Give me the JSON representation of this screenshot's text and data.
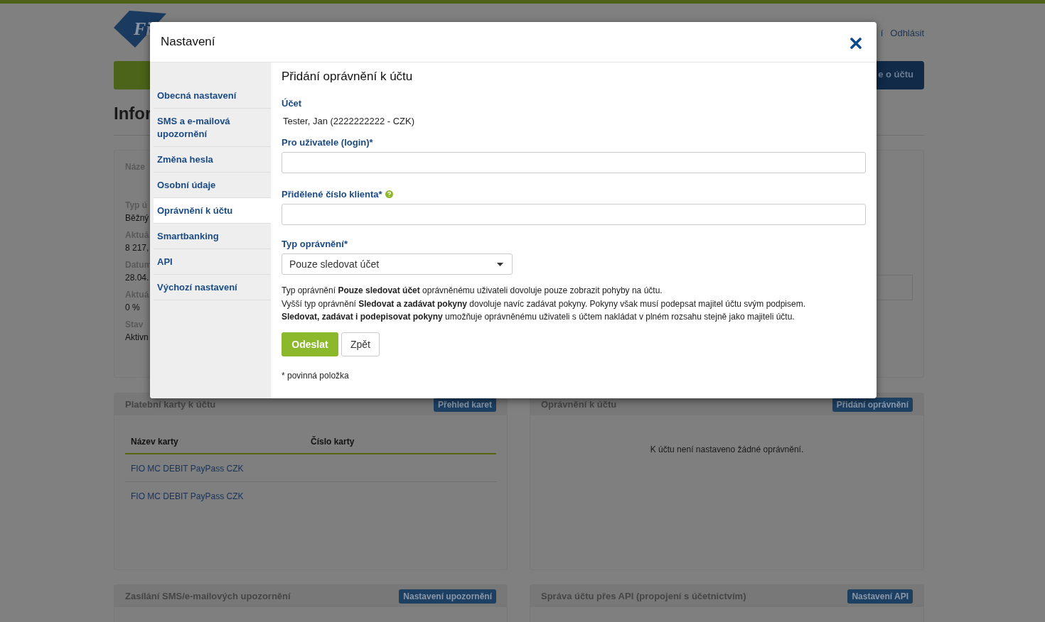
{
  "header": {
    "logo_text": "Fi",
    "links": [
      "í",
      "Odhlásit"
    ]
  },
  "nav": {
    "account_button": "e o účtu"
  },
  "page_heading": "Infor",
  "account_card": {
    "fields": [
      {
        "label": "Náze"
      },
      {
        "label": "Typ ú",
        "value": "Běžný"
      },
      {
        "label": "Aktuá",
        "value": "8 217,"
      },
      {
        "label": "Datum",
        "value": "28.04."
      },
      {
        "label": "Aktuá",
        "value": "0 %"
      },
      {
        "label": "Stav",
        "value": "Aktivn"
      }
    ]
  },
  "panels": [
    {
      "kind": "table",
      "title": "Platební karty k účtu",
      "button": "Přehled karet",
      "columns": [
        "Název karty",
        "Číslo karty"
      ],
      "rows": [
        "FIO MC DEBIT PayPass CZK",
        "FIO MC DEBIT PayPass CZK"
      ]
    },
    {
      "kind": "message",
      "title": "Oprávnění k účtu",
      "button": "Přidání oprávnění",
      "message": "K účtu není nastaveno žádné oprávnění."
    },
    {
      "kind": "collapsed",
      "title": "Zasílání SMS/e-mailových upozornění",
      "button": "Nastavení upozornění"
    },
    {
      "kind": "collapsed",
      "title": "Správa účtu přes API (propojení s účetnictvím)",
      "button": "Nastavení API"
    }
  ],
  "modal": {
    "title": "Nastavení",
    "sidebar": [
      {
        "label": "Obecná nastavení",
        "selected": false
      },
      {
        "label": "SMS a e-mailová upozornění",
        "selected": false
      },
      {
        "label": "Změna hesla",
        "selected": false
      },
      {
        "label": "Osobní údaje",
        "selected": false
      },
      {
        "label": "Oprávnění k účtu",
        "selected": true
      },
      {
        "label": "Smartbanking",
        "selected": false
      },
      {
        "label": "API",
        "selected": false
      },
      {
        "label": "Výchozí nastavení",
        "selected": false
      }
    ],
    "form": {
      "heading": "Přidání oprávnění k účtu",
      "account_label": "Účet",
      "account_value": "Tester, Jan (2222222222 - CZK)",
      "fields": [
        {
          "label": "Pro uživatele (login)*"
        },
        {
          "label": "Přidělené číslo klienta*",
          "help": true
        }
      ],
      "select": {
        "label": "Typ oprávnění*",
        "value": "Pouze sledovat účet"
      },
      "description": [
        "Typ oprávnění **Pouze sledovat účet** oprávněnému uživateli dovoluje pouze zobrazit pohyby na účtu.",
        "Vyšší typ oprávnění **Sledovat a zadávat pokyny** dovoluje navíc zadávat pokyny. Pokyny však musí podepsat majitel účtu svým podpisem.",
        "**Sledovat, zadávat i podepisovat pokyny** umožňuje oprávněnému uživateli s účtem nakládat v plném rozsahu stejně jako majiteli účtu."
      ],
      "submit": "Odeslat",
      "back": "Zpět",
      "note": "* povinná položka"
    }
  }
}
